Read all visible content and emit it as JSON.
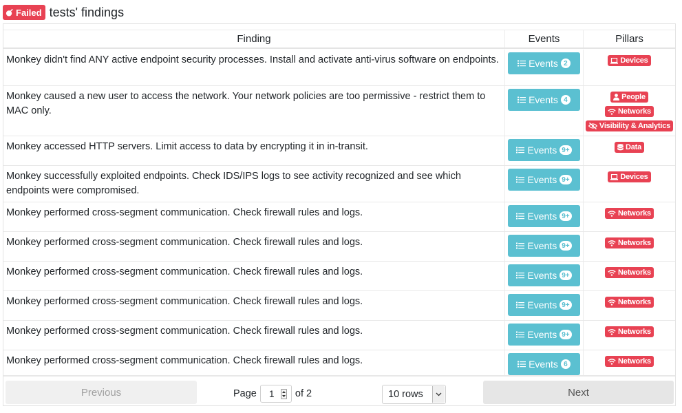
{
  "header": {
    "badge_label": "Failed",
    "badge_icon": "bomb-icon",
    "title": "tests' findings"
  },
  "table": {
    "columns": [
      "Finding",
      "Events",
      "Pillars"
    ],
    "events_label": "Events",
    "rows": [
      {
        "finding": "Monkey didn't find ANY active endpoint security processes. Install and activate anti-virus software on endpoints.",
        "count": "2",
        "pillars": [
          {
            "label": "Devices",
            "icon": "laptop-icon"
          }
        ]
      },
      {
        "finding": "Monkey caused a new user to access the network. Your network policies are too permissive - restrict them to MAC only.",
        "count": "4",
        "pillars": [
          {
            "label": "People",
            "icon": "user-icon"
          },
          {
            "label": "Networks",
            "icon": "wifi-icon"
          },
          {
            "label": "Visibility & Analytics",
            "icon": "eye-slash-icon"
          }
        ]
      },
      {
        "finding": "Monkey accessed HTTP servers. Limit access to data by encrypting it in in-transit.",
        "count": "9+",
        "pillars": [
          {
            "label": "Data",
            "icon": "database-icon"
          }
        ]
      },
      {
        "finding": "Monkey successfully exploited endpoints. Check IDS/IPS logs to see activity recognized and see which endpoints were compromised.",
        "count": "9+",
        "pillars": [
          {
            "label": "Devices",
            "icon": "laptop-icon"
          }
        ]
      },
      {
        "finding": "Monkey performed cross-segment communication. Check firewall rules and logs.",
        "count": "9+",
        "pillars": [
          {
            "label": "Networks",
            "icon": "wifi-icon"
          }
        ]
      },
      {
        "finding": "Monkey performed cross-segment communication. Check firewall rules and logs.",
        "count": "9+",
        "pillars": [
          {
            "label": "Networks",
            "icon": "wifi-icon"
          }
        ]
      },
      {
        "finding": "Monkey performed cross-segment communication. Check firewall rules and logs.",
        "count": "9+",
        "pillars": [
          {
            "label": "Networks",
            "icon": "wifi-icon"
          }
        ]
      },
      {
        "finding": "Monkey performed cross-segment communication. Check firewall rules and logs.",
        "count": "9+",
        "pillars": [
          {
            "label": "Networks",
            "icon": "wifi-icon"
          }
        ]
      },
      {
        "finding": "Monkey performed cross-segment communication. Check firewall rules and logs.",
        "count": "9+",
        "pillars": [
          {
            "label": "Networks",
            "icon": "wifi-icon"
          }
        ]
      },
      {
        "finding": "Monkey performed cross-segment communication. Check firewall rules and logs.",
        "count": "6",
        "pillars": [
          {
            "label": "Networks",
            "icon": "wifi-icon"
          }
        ]
      }
    ]
  },
  "pagination": {
    "previous_label": "Previous",
    "next_label": "Next",
    "page_label": "Page",
    "page_value": "1",
    "of_label": "of 2",
    "rows_option": "10 rows"
  },
  "colors": {
    "failed": "#e84253",
    "events_button": "#5bc0d1"
  }
}
